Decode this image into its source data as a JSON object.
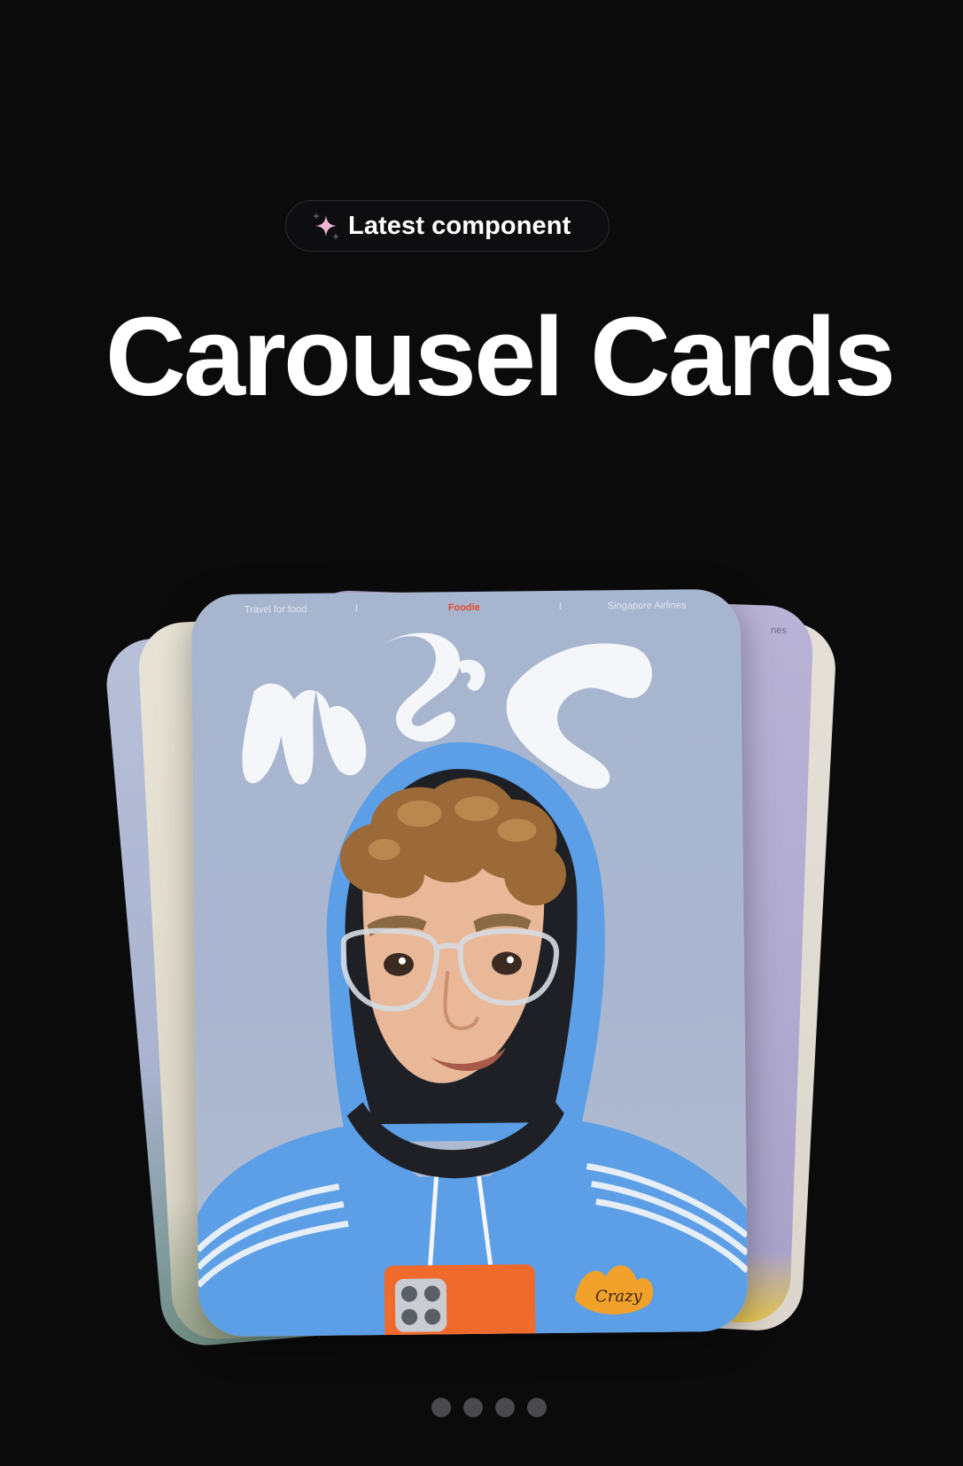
{
  "badge": {
    "label": "Latest component",
    "icon": "sparkle-icon",
    "accent_color": "#f2b5d8"
  },
  "hero": {
    "title": "Carousel Cards"
  },
  "carousel": {
    "front_card": {
      "nav": {
        "left": "Travel for food",
        "separator": "I",
        "middle": "Foodie",
        "right": "Singapore Airlines"
      },
      "colors": {
        "background": "#a8b5cf",
        "hoodie": "#5a9ee6",
        "accent": "#e64a2e"
      }
    },
    "back_card_right_text": "nes",
    "pagination": {
      "count": 4,
      "dot_color": "#4a4a4e"
    }
  }
}
